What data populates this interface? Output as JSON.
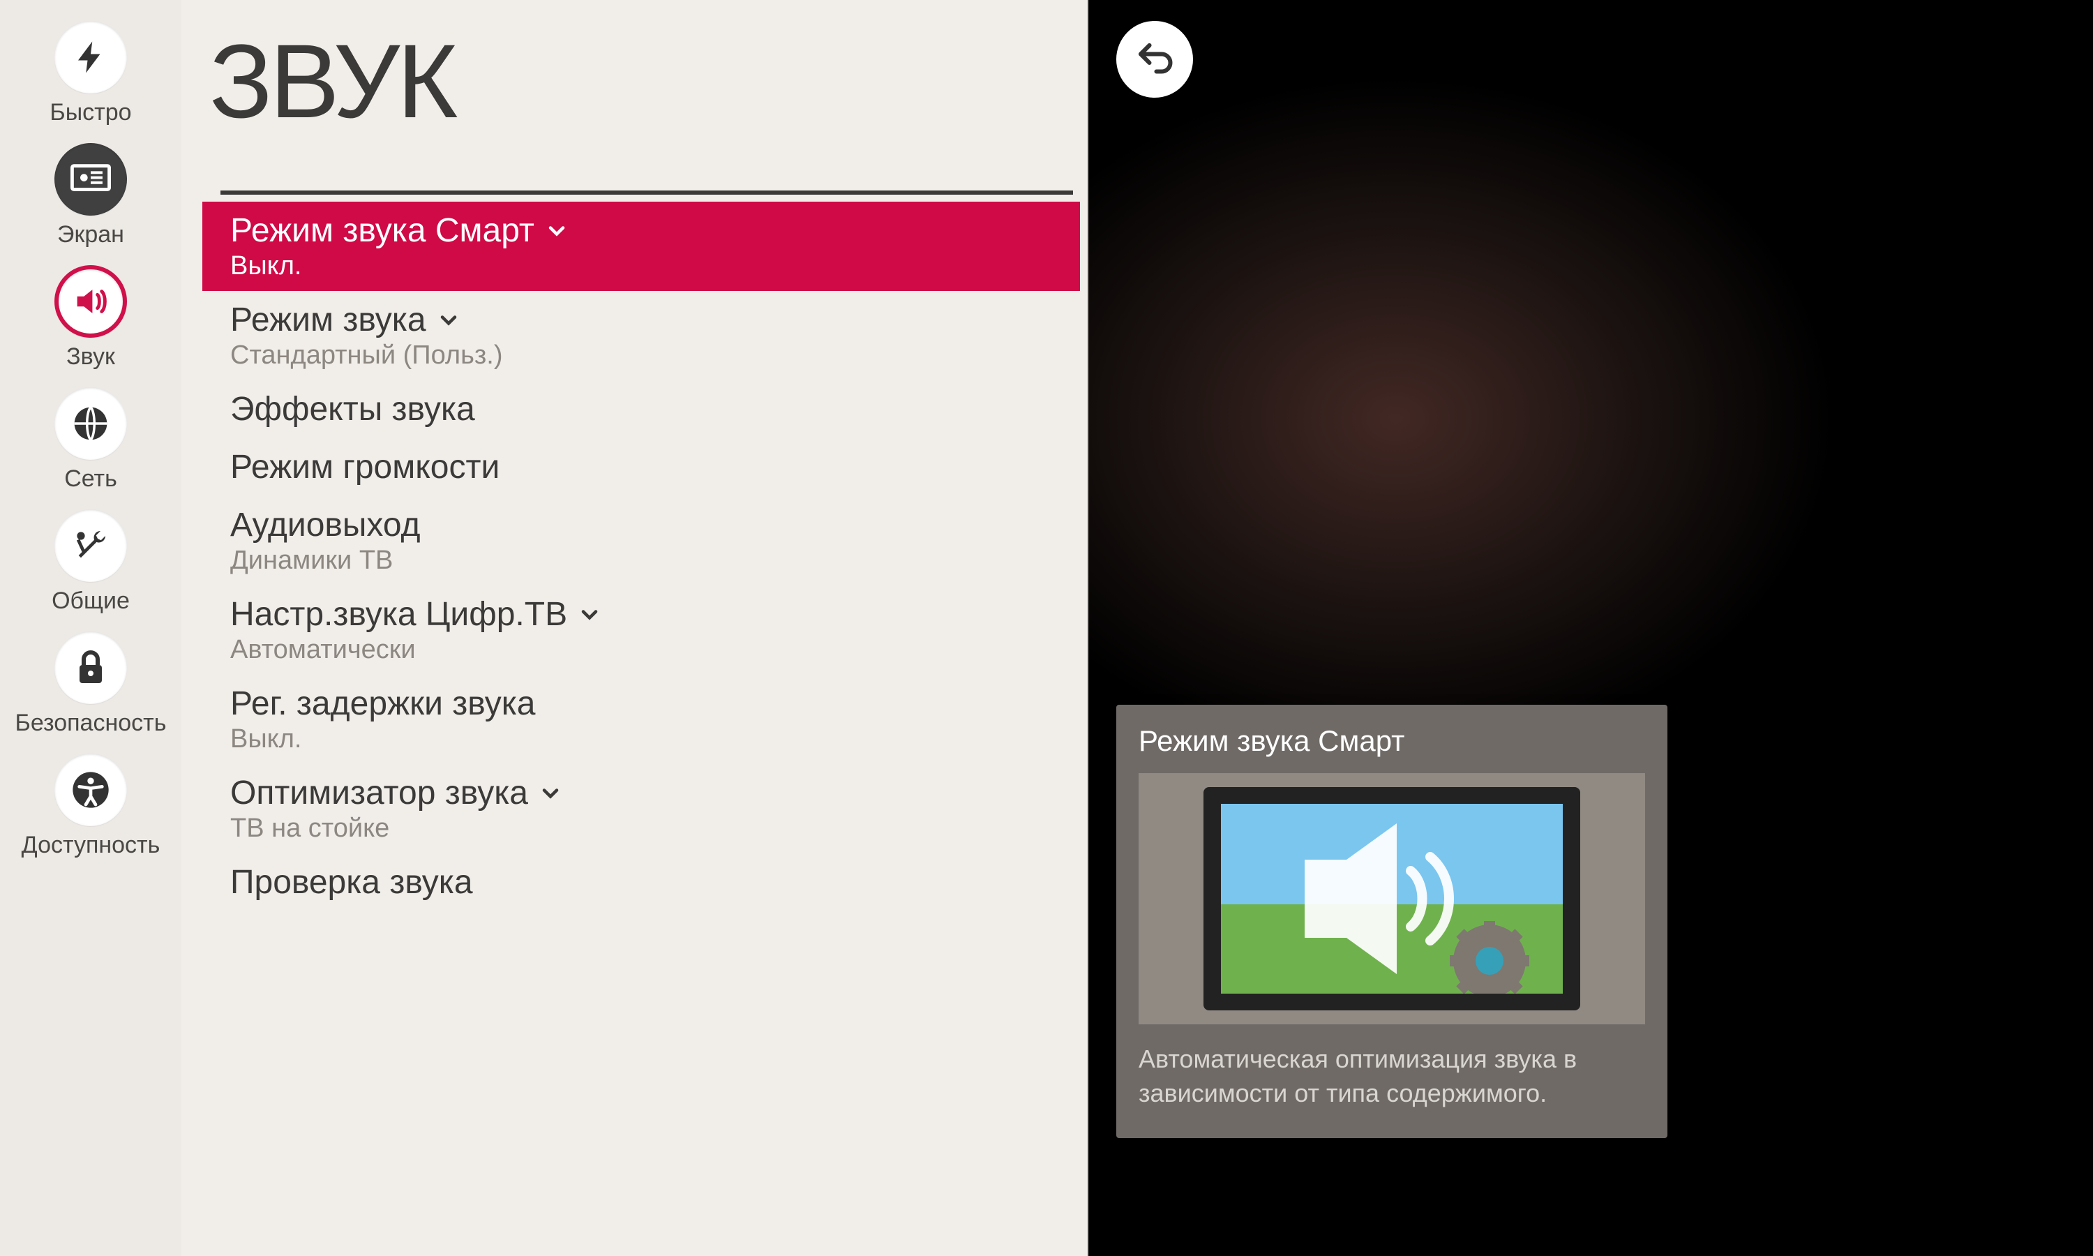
{
  "colors": {
    "accent": "#cf0a46"
  },
  "rail": {
    "items": [
      {
        "id": "quick",
        "label": "Быстро",
        "icon": "bolt"
      },
      {
        "id": "picture",
        "label": "Экран",
        "icon": "screen"
      },
      {
        "id": "sound",
        "label": "Звук",
        "icon": "sound",
        "active": true
      },
      {
        "id": "network",
        "label": "Сеть",
        "icon": "globe"
      },
      {
        "id": "general",
        "label": "Общие",
        "icon": "tools"
      },
      {
        "id": "security",
        "label": "Безопасность",
        "icon": "lock"
      },
      {
        "id": "accessibility",
        "label": "Доступность",
        "icon": "accessibility"
      }
    ]
  },
  "page": {
    "title": "ЗВУК"
  },
  "list": [
    {
      "title": "Режим звука Смарт",
      "sub": "Выкл.",
      "hasMore": true,
      "selected": true
    },
    {
      "title": "Режим звука",
      "sub": "Стандартный (Польз.)",
      "hasMore": true,
      "selected": false
    },
    {
      "title": "Эффекты звука",
      "sub": "",
      "hasMore": false,
      "selected": false
    },
    {
      "title": "Режим громкости",
      "sub": "",
      "hasMore": false,
      "selected": false
    },
    {
      "title": "Аудиовыход",
      "sub": "Динамики ТВ",
      "hasMore": false,
      "selected": false
    },
    {
      "title": "Настр.звука Цифр.ТВ",
      "sub": "Автоматически",
      "hasMore": true,
      "selected": false
    },
    {
      "title": "Рег. задержки звука",
      "sub": "Выкл.",
      "hasMore": false,
      "selected": false
    },
    {
      "title": "Оптимизатор звука",
      "sub": "ТВ на стойке",
      "hasMore": true,
      "selected": false
    },
    {
      "title": "Проверка звука",
      "sub": "",
      "hasMore": false,
      "selected": false
    }
  ],
  "help": {
    "title": "Режим звука Смарт",
    "description": "Автоматическая оптимизация звука в зависимости от типа содержимого."
  },
  "backButton": {
    "aria": "Назад"
  }
}
